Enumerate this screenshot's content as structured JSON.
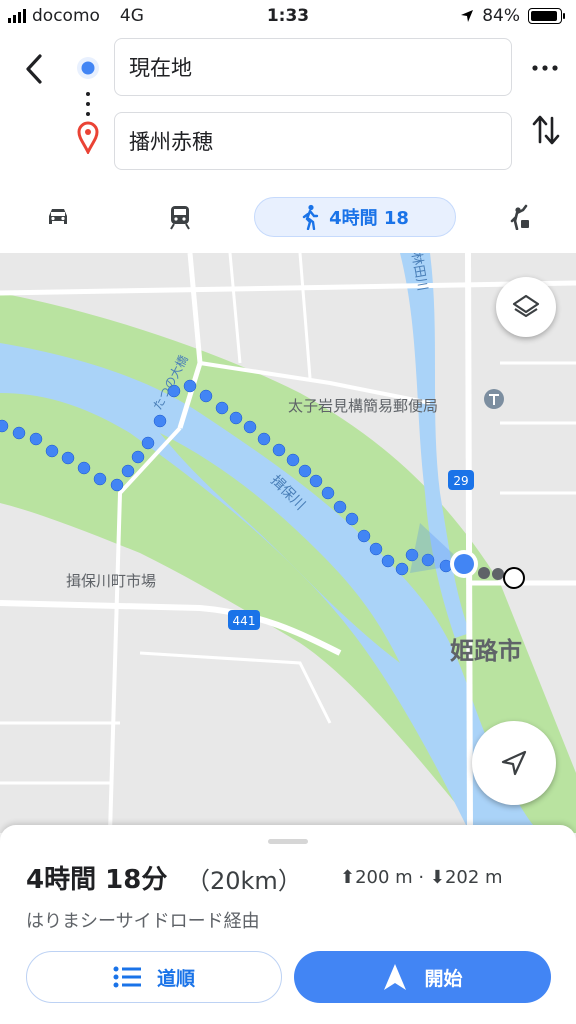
{
  "status_bar": {
    "carrier": "docomo",
    "network": "4G",
    "time": "1:33",
    "battery": "84%"
  },
  "search": {
    "origin": "現在地",
    "destination": "播州赤穂"
  },
  "modes": {
    "walk_duration": "4時間 18"
  },
  "map": {
    "labels": {
      "post_office": "太子岩見構簡易郵便局",
      "route29": "29",
      "route441": "441",
      "market": "揖保川町市場",
      "river": "揖保川",
      "bridge": "たつの大橋",
      "river_upper": "林田川",
      "city": "姫路市"
    }
  },
  "sheet": {
    "duration": "4時間 18分",
    "distance": "（20km）",
    "elevation": "⬆200 m · ⬇202 m",
    "via": "はりまシーサイドロード経由",
    "steps_button": "道順",
    "start_button": "開始"
  },
  "colors": {
    "accent": "#4285f4",
    "route_blue": "#4285f4",
    "water": "#aad3f8",
    "park": "#b9e3a0"
  }
}
